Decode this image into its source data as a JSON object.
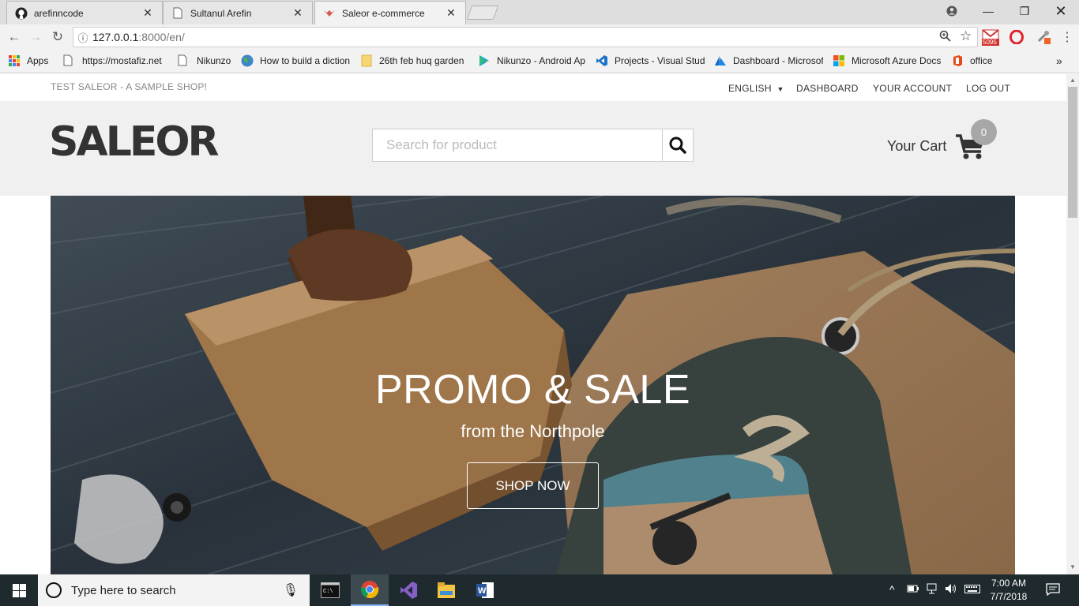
{
  "browser": {
    "tabs": [
      {
        "title": "arefinncode",
        "icon": "github-icon"
      },
      {
        "title": "Sultanul Arefin",
        "icon": "page-icon"
      },
      {
        "title": "Saleor e-commerce",
        "icon": "saleor-icon"
      }
    ],
    "url_host": "127.0.0.1",
    "url_path": ":8000/en/",
    "gmail_count": "5095",
    "bookmarks": [
      {
        "label": "Apps",
        "icon": "apps-grid-icon"
      },
      {
        "label": "https://mostafiz.net",
        "icon": "page-icon"
      },
      {
        "label": "Nikunzo",
        "icon": "page-icon"
      },
      {
        "label": "How to build a dictionary",
        "icon": "globe-icon"
      },
      {
        "label": "26th feb huq garden",
        "icon": "folder-icon"
      },
      {
        "label": "Nikunzo - Android Apps",
        "icon": "play-store-icon"
      },
      {
        "label": "Projects - Visual Studio",
        "icon": "visual-studio-icon"
      },
      {
        "label": "Dashboard - Microsoft Azure",
        "icon": "azure-icon"
      },
      {
        "label": "Microsoft Azure Docs",
        "icon": "microsoft-icon"
      },
      {
        "label": "office",
        "icon": "office-icon"
      }
    ]
  },
  "shop": {
    "tagline": "TEST SALEOR - A SAMPLE SHOP!",
    "nav": {
      "language": "ENGLISH",
      "dashboard": "DASHBOARD",
      "account": "YOUR ACCOUNT",
      "logout": "LOG OUT"
    },
    "logo": "SALEOR",
    "search_placeholder": "Search for product",
    "cart_label": "Your Cart",
    "cart_count": "0",
    "hero": {
      "title": "PROMO & SALE",
      "subtitle": "from the Northpole",
      "cta": "SHOP NOW"
    }
  },
  "taskbar": {
    "search_placeholder": "Type here to search",
    "time": "7:00 AM",
    "date": "7/7/2018",
    "apps": [
      "terminal-icon",
      "chrome-icon",
      "visual-studio-icon",
      "file-explorer-icon",
      "word-icon"
    ]
  }
}
